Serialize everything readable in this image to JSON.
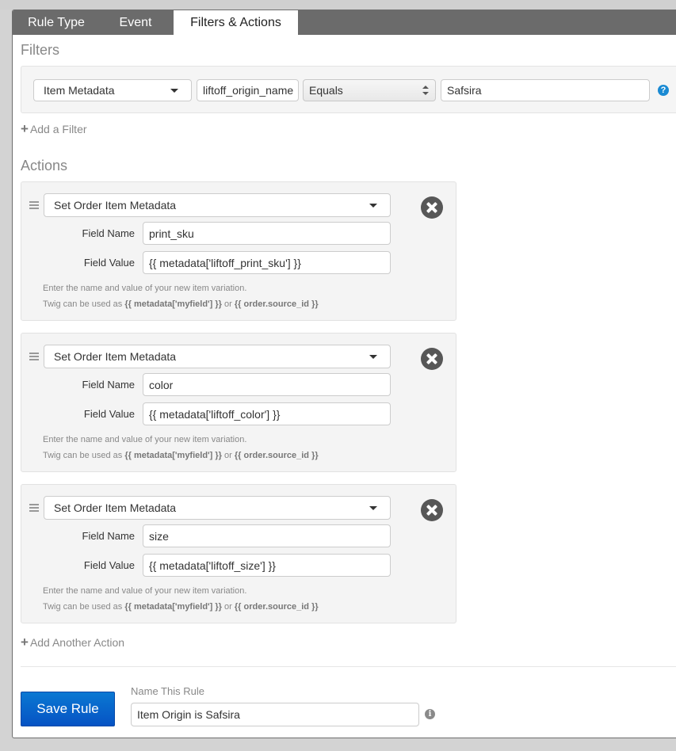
{
  "tabs": [
    {
      "label": "Rule Type",
      "active": false
    },
    {
      "label": "Event",
      "active": false
    },
    {
      "label": "Filters & Actions",
      "active": true
    }
  ],
  "filters": {
    "title": "Filters",
    "row": {
      "type": "Item Metadata",
      "key": "liftoff_origin_name",
      "operator": "Equals",
      "value": "Safsira",
      "help_icon": "?"
    },
    "add_label": "Add a Filter"
  },
  "actions": {
    "title": "Actions",
    "items": [
      {
        "type": "Set Order Item Metadata",
        "field_name_label": "Field Name",
        "field_name": "print_sku",
        "field_value_label": "Field Value",
        "field_value": "{{ metadata['liftoff_print_sku'] }}"
      },
      {
        "type": "Set Order Item Metadata",
        "field_name_label": "Field Name",
        "field_name": "color",
        "field_value_label": "Field Value",
        "field_value": "{{ metadata['liftoff_color'] }}"
      },
      {
        "type": "Set Order Item Metadata",
        "field_name_label": "Field Name",
        "field_name": "size",
        "field_value_label": "Field Value",
        "field_value": "{{ metadata['liftoff_size'] }}"
      }
    ],
    "hint_line1": "Enter the name and value of your new item variation.",
    "hint_prefix": "Twig can be used as ",
    "hint_code1": "{{ metadata['myfield'] }}",
    "hint_or": " or ",
    "hint_code2": "{{ order.source_id }}",
    "add_label": "Add Another Action"
  },
  "footer": {
    "save_label": "Save Rule",
    "name_label": "Name This Rule",
    "name_value": "Item Origin is Safsira",
    "info_icon": "i"
  }
}
